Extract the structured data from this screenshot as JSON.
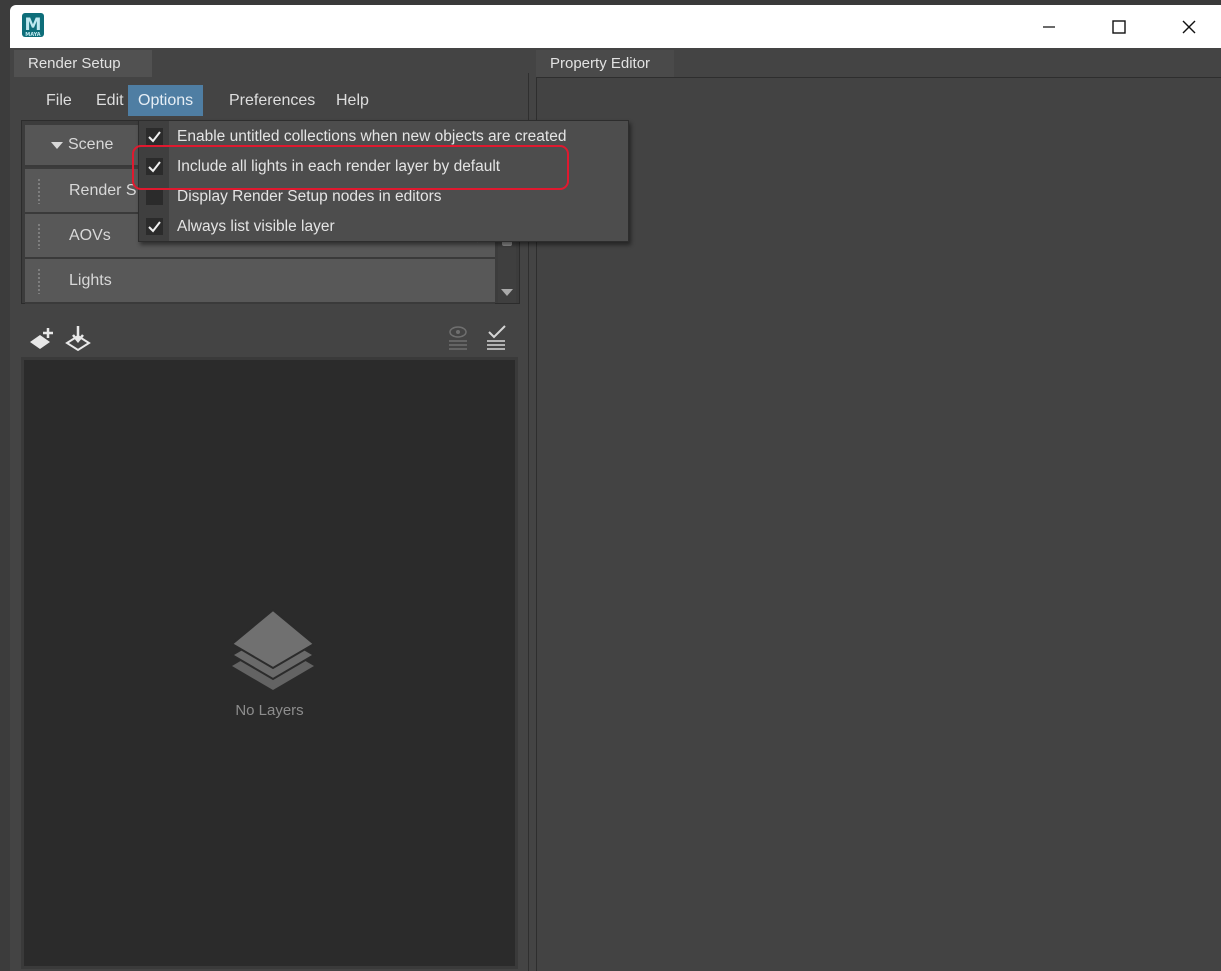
{
  "window": {
    "app_icon_letter": "M",
    "app_icon_small": "MAYA",
    "controls": {
      "minimize": "minimize",
      "maximize": "maximize",
      "close": "close"
    }
  },
  "tabs": {
    "render_setup": "Render Setup",
    "property_editor": "Property Editor"
  },
  "menubar": [
    "File",
    "Edit",
    "Options",
    "Preferences",
    "Help"
  ],
  "active_menu": "Options",
  "scene_list": {
    "header": "Scene",
    "rows": [
      "Render S",
      "AOVs",
      "Lights"
    ]
  },
  "options_menu": {
    "items": [
      {
        "label": "Enable untitled collections when new objects are created",
        "checked": true
      },
      {
        "label": "Include all lights in each render layer by default",
        "checked": true
      },
      {
        "label": "Display Render Setup nodes in editors",
        "checked": false
      },
      {
        "label": "Always list visible layer",
        "checked": true
      }
    ],
    "highlighted_index": 1,
    "highlight_color": "#e0192f"
  },
  "layers": {
    "empty_text": "No Layers"
  },
  "colors": {
    "accent": "#4f7ea3",
    "panel": "#444444",
    "layers_bg": "#2b2b2b"
  }
}
